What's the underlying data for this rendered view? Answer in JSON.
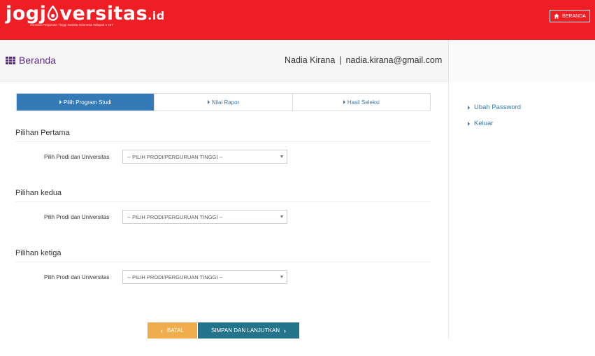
{
  "header": {
    "logo_main": "jogj",
    "logo_rest": "versitas",
    "logo_suffix": ".id",
    "logo_tagline": "Asosiasi Perguruan Tinggi Swasta Indonesia Wilayah V DIY",
    "home_label": "BERANDA",
    "accent_color": "#ef1d24"
  },
  "titlebar": {
    "page_title": "Beranda",
    "user_name": "Nadia Kirana",
    "separator": "|",
    "user_email": "nadia.kirana@gmail.com"
  },
  "steps": [
    {
      "label": "Pilih Program Studi",
      "active": true
    },
    {
      "label": "Nilai Rapor",
      "active": false
    },
    {
      "label": "Hasil Seleksi",
      "active": false
    }
  ],
  "sections": [
    {
      "title": "Pilihan Pertama",
      "field_label": "Pilih Prodi dan Universitas",
      "selected": "-- PILIH PRODI/PERGURUAN TINGGI --"
    },
    {
      "title": "Pilihan kedua",
      "field_label": "Pilih Prodi dan Universitas",
      "selected": "-- PILIH PRODI/PERGURUAN TINGGI --"
    },
    {
      "title": "Pilihan ketiga",
      "field_label": "Pilih Prodi dan Universitas",
      "selected": "-- PILIH PRODI/PERGURUAN TINGGI --"
    }
  ],
  "buttons": {
    "cancel_label": "BATAL",
    "save_label": "SIMPAN DAN LANJUTKAN"
  },
  "sidebar": {
    "links": [
      {
        "label": "Ubah Password"
      },
      {
        "label": "Keluar"
      }
    ]
  }
}
